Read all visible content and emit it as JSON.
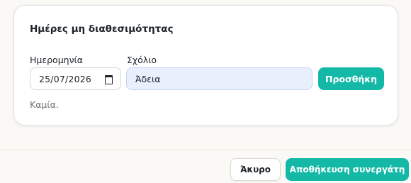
{
  "section": {
    "title": "Ημέρες μη διαθεσιμότητας",
    "date_label": "Ημερομηνία",
    "date_value": "25/07/2026",
    "date_icon": "calendar-icon",
    "comment_label": "Σχόλιο",
    "comment_value": "Άδεια",
    "add_button_label": "Προσθήκη",
    "empty_text": "Καμία."
  },
  "footer": {
    "cancel_label": "Άκυρο",
    "save_label": "Αποθήκευση συνεργάτη"
  },
  "colors": {
    "accent": "#14b8a6",
    "input_autofill_bg": "#e8f0fe",
    "page_bg": "#fbf9f5"
  }
}
